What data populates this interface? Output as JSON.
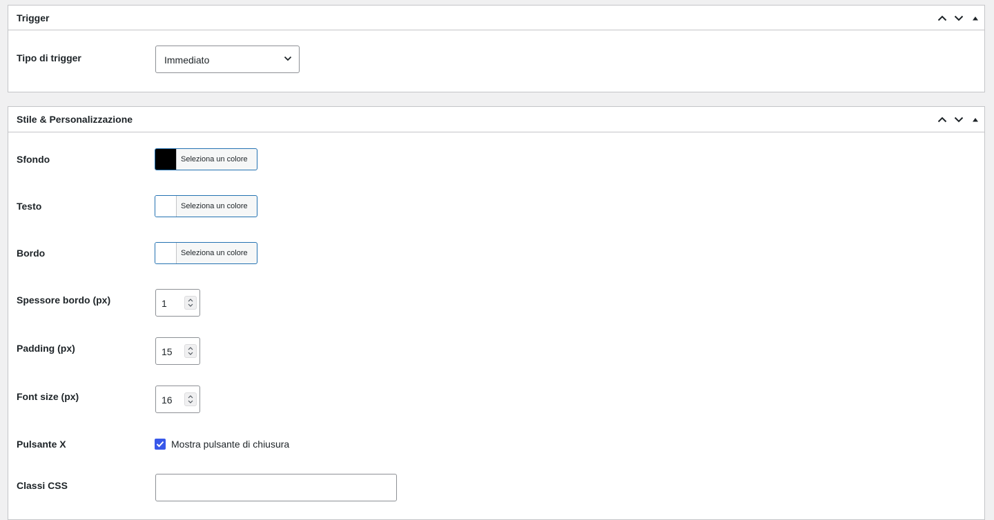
{
  "trigger_box": {
    "title": "Trigger",
    "trigger_type": {
      "label": "Tipo di trigger",
      "selected": "Immediato"
    }
  },
  "style_box": {
    "title": "Stile & Personalizzazione",
    "background": {
      "label": "Sfondo",
      "button_text": "Seleziona un colore",
      "color": "#000000"
    },
    "text": {
      "label": "Testo",
      "button_text": "Seleziona un colore",
      "color": "#ffffff"
    },
    "border": {
      "label": "Bordo",
      "button_text": "Seleziona un colore",
      "color": "#ffffff"
    },
    "border_width": {
      "label": "Spessore bordo (px)",
      "value": "1"
    },
    "padding": {
      "label": "Padding (px)",
      "value": "15"
    },
    "font_size": {
      "label": "Font size (px)",
      "value": "16"
    },
    "close_button": {
      "label": "Pulsante X",
      "checkbox_label": "Mostra pulsante di chiusura",
      "checked": true
    },
    "css_classes": {
      "label": "Classi CSS",
      "value": ""
    }
  },
  "icons": {
    "move_up": "chevron-up-icon",
    "move_down": "chevron-down-icon",
    "toggle": "triangle-up-icon"
  },
  "colors": {
    "accent": "#2271b1",
    "checkbox": "#3858e9",
    "border": "#c3c4c7",
    "page_bg": "#f0f0f1"
  }
}
